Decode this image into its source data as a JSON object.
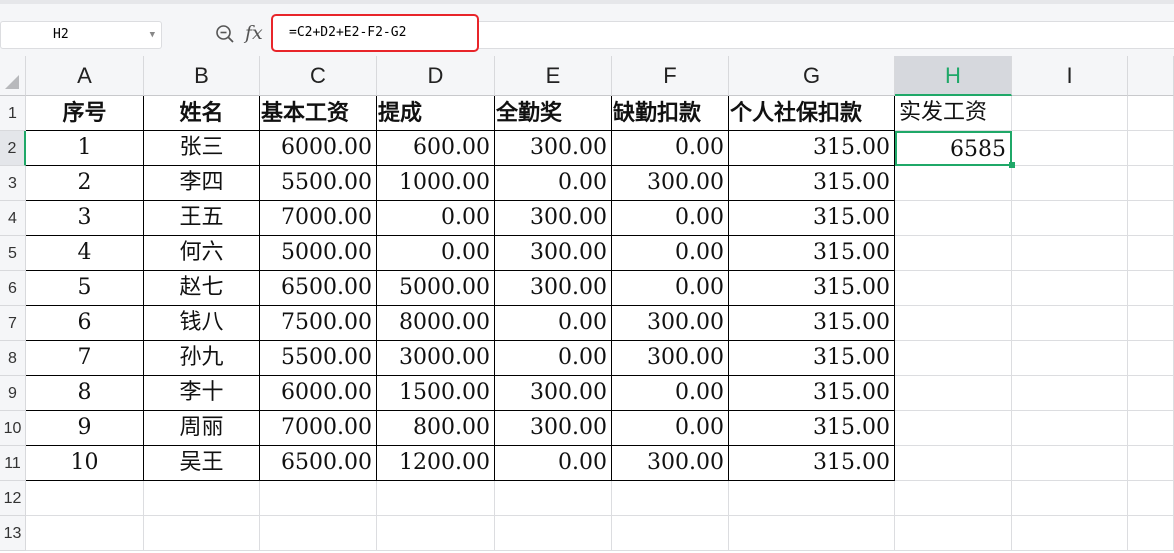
{
  "name_box": "H2",
  "formula": "=C2+D2+E2-F2-G2",
  "icons": {
    "zoom": "zoom-out-icon",
    "fx": "fx"
  },
  "columns": [
    "A",
    "B",
    "C",
    "D",
    "E",
    "F",
    "G",
    "H",
    "I"
  ],
  "selected_column": "H",
  "row_numbers": [
    "1",
    "2",
    "3",
    "4",
    "5",
    "6",
    "7",
    "8",
    "9",
    "10",
    "11",
    "12",
    "13"
  ],
  "headers": [
    "序号",
    "姓名",
    "基本工资",
    "提成",
    "全勤奖",
    "缺勤扣款",
    "个人社保扣款",
    "实发工资"
  ],
  "rows": [
    [
      "1",
      "张三",
      "6000.00",
      "600.00",
      "300.00",
      "0.00",
      "315.00",
      "6585"
    ],
    [
      "2",
      "李四",
      "5500.00",
      "1000.00",
      "0.00",
      "300.00",
      "315.00",
      ""
    ],
    [
      "3",
      "王五",
      "7000.00",
      "0.00",
      "300.00",
      "0.00",
      "315.00",
      ""
    ],
    [
      "4",
      "何六",
      "5000.00",
      "0.00",
      "300.00",
      "0.00",
      "315.00",
      ""
    ],
    [
      "5",
      "赵七",
      "6500.00",
      "5000.00",
      "300.00",
      "0.00",
      "315.00",
      ""
    ],
    [
      "6",
      "钱八",
      "7500.00",
      "8000.00",
      "0.00",
      "300.00",
      "315.00",
      ""
    ],
    [
      "7",
      "孙九",
      "5500.00",
      "3000.00",
      "0.00",
      "300.00",
      "315.00",
      ""
    ],
    [
      "8",
      "李十",
      "6000.00",
      "1500.00",
      "300.00",
      "0.00",
      "315.00",
      ""
    ],
    [
      "9",
      "周丽",
      "7000.00",
      "800.00",
      "300.00",
      "0.00",
      "315.00",
      ""
    ],
    [
      "10",
      "吴王",
      "6500.00",
      "1200.00",
      "0.00",
      "300.00",
      "315.00",
      ""
    ]
  ],
  "colors": {
    "accent": "#1fa868",
    "highlight": "#e8252a"
  }
}
